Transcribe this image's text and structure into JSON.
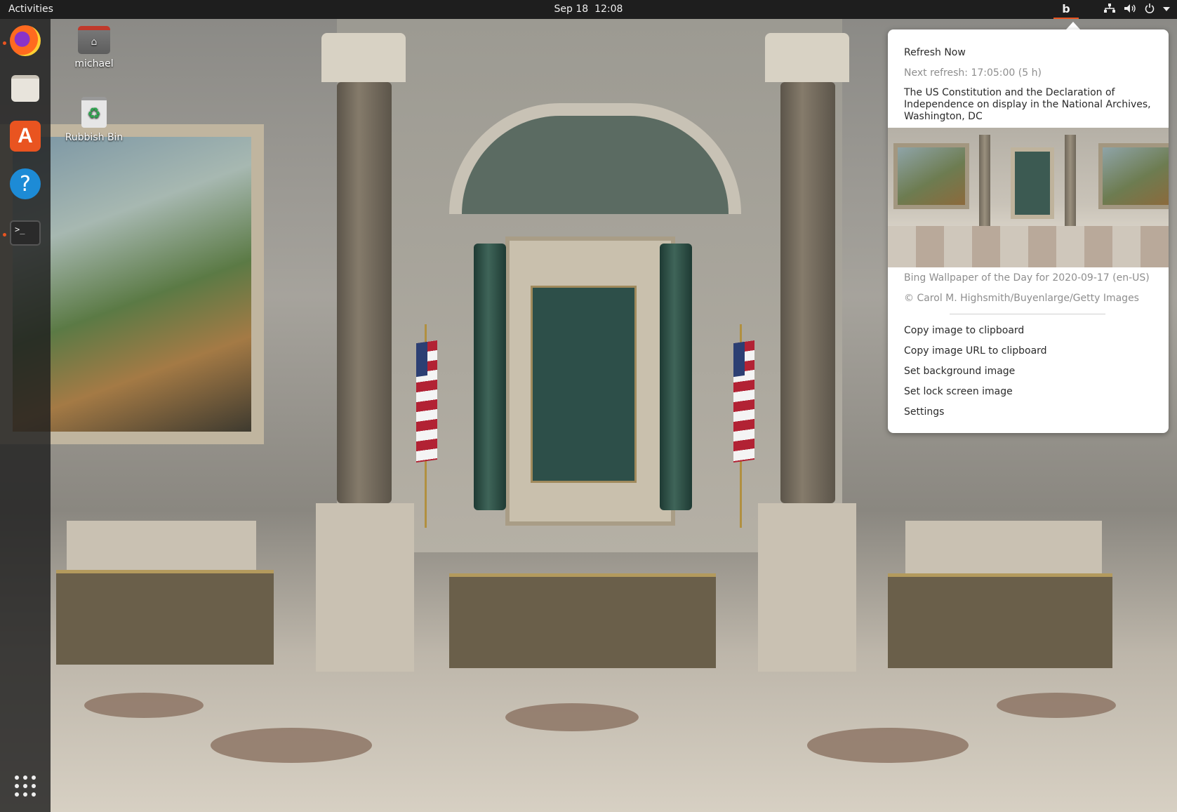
{
  "topbar": {
    "activities": "Activities",
    "date": "Sep 18",
    "time": "12:08",
    "tray_icons": [
      "bing-wallpaper-icon",
      "network-icon",
      "volume-icon",
      "power-icon",
      "chevron-down-icon"
    ]
  },
  "dock": {
    "apps": [
      {
        "name": "firefox",
        "running": true
      },
      {
        "name": "files",
        "running": false
      },
      {
        "name": "ubuntu-software",
        "running": false
      },
      {
        "name": "help",
        "running": false
      },
      {
        "name": "terminal",
        "running": true
      }
    ],
    "show_apps": "app-grid-icon"
  },
  "desktop": {
    "home_label": "michael",
    "trash_label": "Rubbish Bin"
  },
  "menu": {
    "refresh_now": "Refresh Now",
    "next_refresh": "Next refresh: 17:05:00 (5 h)",
    "image_title": "The US Constitution and the Declaration of Independence on display in the National Archives, Washington, DC",
    "wallpaper_info": "Bing Wallpaper of the Day for 2020-09-17 (en-US)",
    "copyright": "© Carol M. Highsmith/Buyenlarge/Getty Images",
    "copy_image": "Copy image to clipboard",
    "copy_url": "Copy image URL to clipboard",
    "set_background": "Set background image",
    "set_lock": "Set lock screen image",
    "settings": "Settings"
  },
  "colors": {
    "accent": "#e95420",
    "topbar": "#1e1e1e",
    "menu_bg": "#ffffff"
  }
}
